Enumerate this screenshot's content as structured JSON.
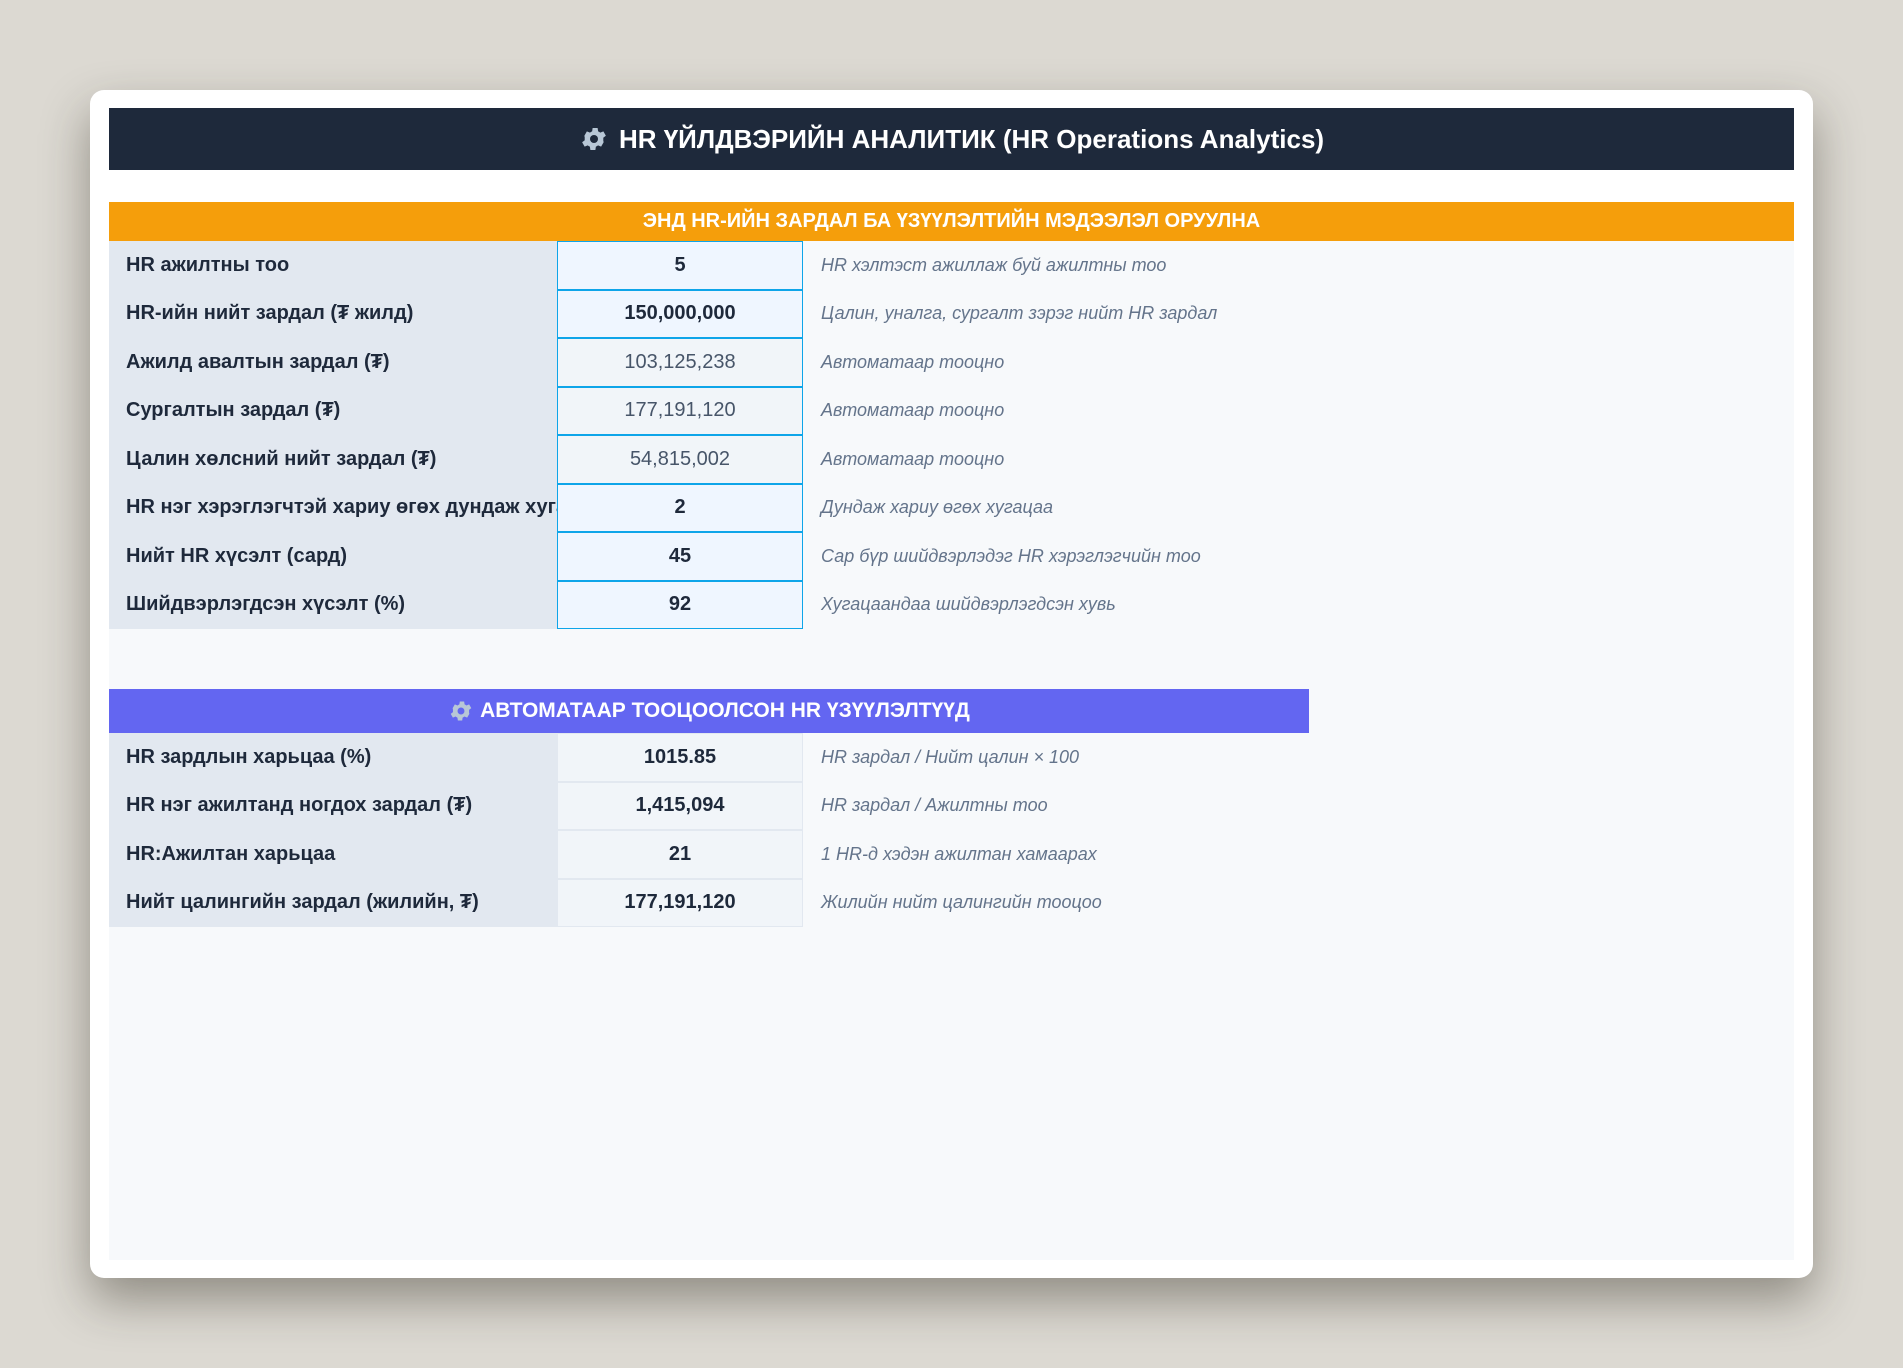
{
  "title": "HR ҮЙЛДВЭРИЙН АНАЛИТИК (HR Operations Analytics)",
  "input_section": {
    "header": "ЭНД HR-ИЙН ЗАРДАЛ БА ҮЗҮҮЛЭЛТИЙН МЭДЭЭЛЭЛ ОРУУЛНА",
    "rows": [
      {
        "label": "HR ажилтны тоо",
        "value": "5",
        "note": "HR хэлтэст ажиллаж буй ажилтны тоо",
        "kind": "input"
      },
      {
        "label": "HR-ийн нийт зардал (₮ жилд)",
        "value": "150,000,000",
        "note": "Цалин, уналга, сургалт зэрэг нийт HR зардал",
        "kind": "input"
      },
      {
        "label": "Ажилд авалтын зардал (₮)",
        "value": "103,125,238",
        "note": "Автоматаар тооцно",
        "kind": "auto"
      },
      {
        "label": "Сургалтын зардал (₮)",
        "value": "177,191,120",
        "note": "Автоматаар тооцно",
        "kind": "auto"
      },
      {
        "label": "Цалин хөлсний нийт зардал (₮)",
        "value": "54,815,002",
        "note": "Автоматаар тооцно",
        "kind": "auto"
      },
      {
        "label": "HR нэг хэрэглэгчтэй хариу өгөх дундаж хугацаа",
        "value": "2",
        "note": "Дундаж хариу өгөх хугацаа",
        "kind": "input"
      },
      {
        "label": "Нийт HR хүсэлт (сард)",
        "value": "45",
        "note": "Сар бүр шийдвэрлэдэг HR хэрэглэгчийн тоо",
        "kind": "input"
      },
      {
        "label": "Шийдвэрлэгдсэн хүсэлт (%)",
        "value": "92",
        "note": "Хугацаандаа шийдвэрлэгдсэн хувь",
        "kind": "input"
      }
    ]
  },
  "calc_section": {
    "header": "АВТОМАТААР ТООЦООЛСОН HR ҮЗҮҮЛЭЛТҮҮД",
    "rows": [
      {
        "label": "HR зардлын харьцаа (%)",
        "value": "1015.85",
        "note": "HR зардал / Нийт цалин × 100"
      },
      {
        "label": "HR нэг ажилтанд ногдох зардал (₮)",
        "value": "1,415,094",
        "note": "HR зардал / Ажилтны тоо"
      },
      {
        "label": "HR:Ажилтан харьцаа",
        "value": "21",
        "note": "1 HR-д хэдэн ажилтан хамаарах"
      },
      {
        "label": "Нийт цалингийн зардал (жилийн, ₮)",
        "value": "177,191,120",
        "note": "Жилийн нийт цалингийн тооцоо"
      }
    ]
  },
  "icons": {
    "title_icon": "gear-icon",
    "calc_header_icon": "gear-icon"
  },
  "colors": {
    "title_bg": "#1e293b",
    "input_header_bg": "#f59e0b",
    "calc_header_bg": "#6366f1",
    "input_border": "#0ea5e9"
  }
}
